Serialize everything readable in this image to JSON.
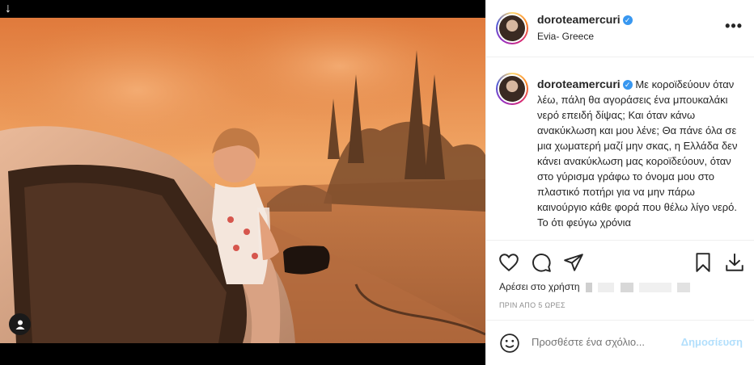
{
  "post": {
    "username": "doroteamercuri",
    "verified_mark": "✓",
    "location": "Evia- Greece",
    "more_label": "•••",
    "caption": "Με κοροϊδεύουν όταν λέω, πάλη θα αγοράσεις ένα μπουκαλάκι νερό επειδή δίψας; Και όταν κάνω ανακύκλωση και μου λένε; Θα πάνε όλα σε μια χωματερή μαζί μην σκας, η Ελλάδα δεν κάνει ανακύκλωση μας κοροϊδεύουν, όταν στο γύρισμα γράφω το όνομα μου στο πλαστικό ποτήρι για να μην πάρω καινούργιο κάθε φορά που θέλω λίγο νερό. Το ότι φεύγω χρόνια",
    "likes_prefix": "Αρέσει στο χρήστη",
    "time": "ΠΡΙΝ ΑΠΟ 5 ΩΡΕΣ",
    "comment_placeholder": "Προσθέστε ένα σχόλιο...",
    "post_label": "Δημοσίευση"
  },
  "media": {
    "download_icon": "↓"
  },
  "icons": [
    "download-icon",
    "user-tag-icon",
    "heart-icon",
    "comment-icon",
    "share-icon",
    "bookmark-icon",
    "save-download-icon",
    "emoji-icon",
    "more-icon",
    "verified-icon"
  ],
  "colors": {
    "accent": "#3897f0",
    "post_disabled": "#b2dffc",
    "sky": "#e8934f",
    "fire_glow": "#f0a060"
  }
}
